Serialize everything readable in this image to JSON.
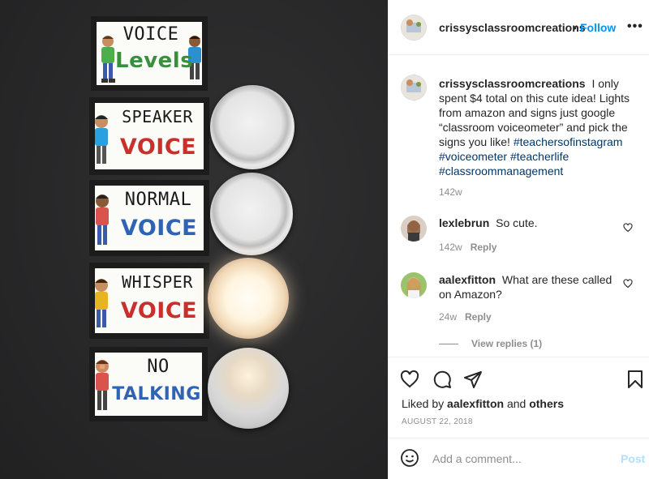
{
  "photo": {
    "signs": [
      {
        "line1": "VOICE",
        "line2": "Levels"
      },
      {
        "line1": "SPEAKER",
        "line2": "VOICE"
      },
      {
        "line1": "NORMAL",
        "line2": "VOICE"
      },
      {
        "line1": "WHISPER",
        "line2": "VOICE"
      },
      {
        "line1": "NO",
        "line2": "TALKING"
      }
    ]
  },
  "header": {
    "username": "crissysclassroomcreations",
    "separator": "•",
    "follow_label": "Follow",
    "more_label": "•••"
  },
  "caption": {
    "username": "crissysclassroomcreations",
    "text": "I only spent $4 total on this cute idea! Lights from amazon and signs just google “classroom voiceometer” and pick the signs you like!",
    "hashtags": [
      "#teachersofinstagram",
      "#voiceometer",
      "#teacherlife",
      "#classroommanagement"
    ],
    "time": "142w"
  },
  "comments": [
    {
      "username": "lexlebrun",
      "text": "So cute.",
      "time": "142w",
      "reply_label": "Reply"
    },
    {
      "username": "aalexfitton",
      "text": "What are these called on Amazon?",
      "time": "24w",
      "reply_label": "Reply"
    }
  ],
  "view_replies_label": "View replies (1)",
  "likes": {
    "prefix": "Liked by",
    "user": "aalexfitton",
    "conjunction": "and",
    "others": "others"
  },
  "date": "AUGUST 22, 2018",
  "add_comment": {
    "placeholder": "Add a comment...",
    "post_label": "Post"
  },
  "icons": {
    "heart": "heart-icon",
    "comment": "comment-icon",
    "share": "share-icon",
    "save": "bookmark-icon",
    "emoji": "emoji-icon"
  },
  "colors": {
    "link": "#0095f6",
    "hashtag": "#00376b",
    "muted": "#8e8e8e",
    "post_disabled": "#b2dffc"
  }
}
